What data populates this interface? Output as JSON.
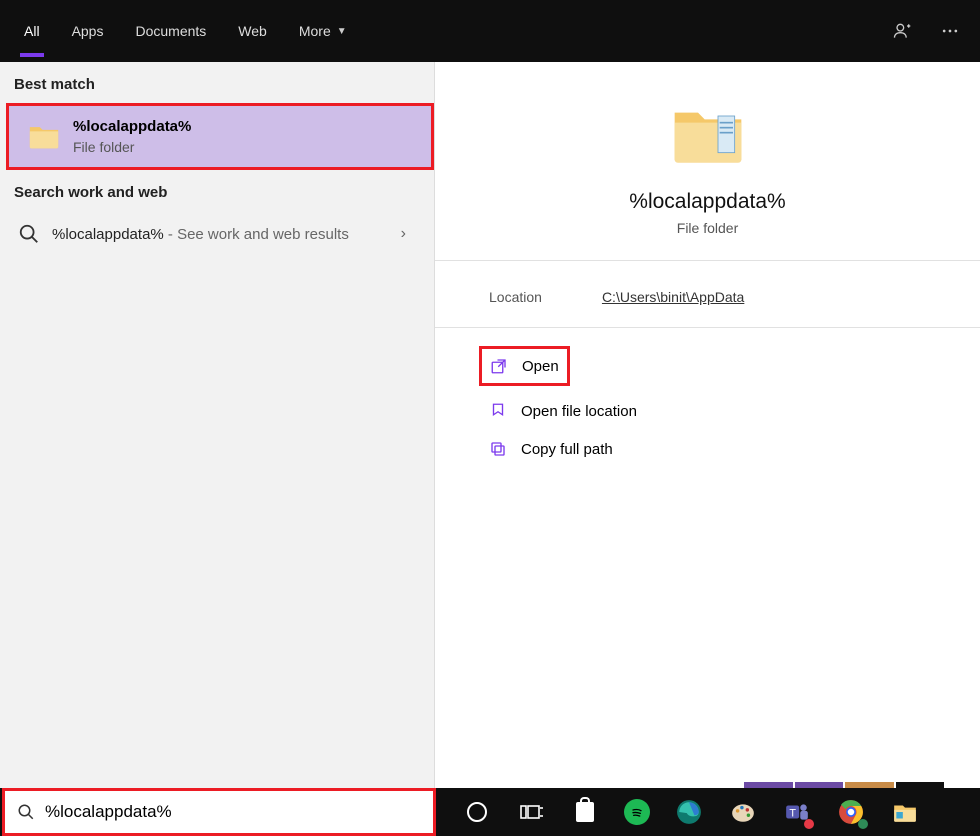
{
  "tabs": {
    "all": "All",
    "apps": "Apps",
    "documents": "Documents",
    "web": "Web",
    "more": "More"
  },
  "sections": {
    "best_match": "Best match",
    "search_web": "Search work and web"
  },
  "result": {
    "title": "%localappdata%",
    "subtitle": "File folder"
  },
  "web_result": {
    "query": "%localappdata%",
    "suffix": " - See work and web results"
  },
  "preview": {
    "title": "%localappdata%",
    "subtitle": "File folder",
    "location_label": "Location",
    "location_value": "C:\\Users\\binit\\AppData"
  },
  "actions": {
    "open": "Open",
    "open_location": "Open file location",
    "copy_path": "Copy full path"
  },
  "searchbox": {
    "value": "%localappdata%"
  }
}
